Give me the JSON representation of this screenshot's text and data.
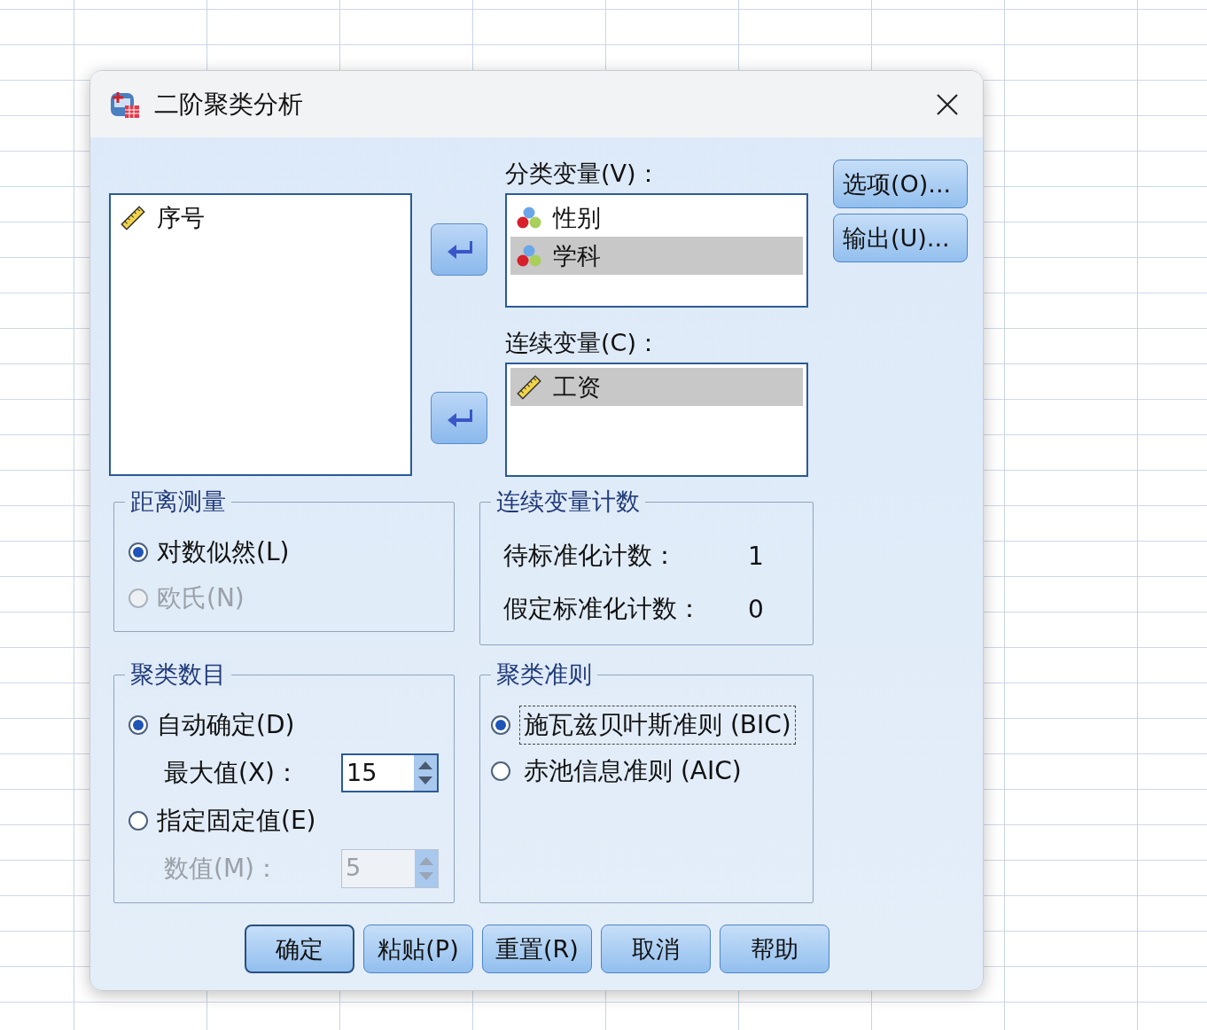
{
  "window": {
    "title": "二阶聚类分析"
  },
  "source_list": {
    "items": [
      {
        "label": "序号",
        "kind": "scale",
        "selected": false
      }
    ]
  },
  "categorical": {
    "label": "分类变量(V)：",
    "items": [
      {
        "label": "性别",
        "kind": "nominal",
        "selected": false
      },
      {
        "label": "学科",
        "kind": "nominal",
        "selected": true
      }
    ]
  },
  "continuous": {
    "label": "连续变量(C)：",
    "items": [
      {
        "label": "工资",
        "kind": "scale",
        "selected": true
      }
    ]
  },
  "side_buttons": [
    "选项(O)...",
    "输出(U)..."
  ],
  "distance": {
    "title": "距离测量",
    "options": [
      {
        "label": "对数似然(L)",
        "selected": true,
        "disabled": false
      },
      {
        "label": "欧氏(N)",
        "selected": false,
        "disabled": true
      }
    ]
  },
  "counts": {
    "title": "连续变量计数",
    "rows": [
      {
        "label": "待标准化计数：",
        "value": "1"
      },
      {
        "label": "假定标准化计数：",
        "value": "0"
      }
    ]
  },
  "cluster_number": {
    "title": "聚类数目",
    "options": [
      {
        "label": "自动确定(D)",
        "selected": true,
        "disabled": false,
        "field": {
          "label": "最大值(X)：",
          "value": "15",
          "disabled": false
        }
      },
      {
        "label": "指定固定值(E)",
        "selected": false,
        "disabled": false,
        "field": {
          "label": "数值(M)：",
          "value": "5",
          "disabled": true
        }
      }
    ]
  },
  "criterion": {
    "title": "聚类准则",
    "options": [
      {
        "label": "施瓦兹贝叶斯准则 (BIC)",
        "selected": true,
        "focused": true
      },
      {
        "label": "赤池信息准则 (AIC)",
        "selected": false,
        "focused": false
      }
    ]
  },
  "buttons": [
    {
      "label": "确定",
      "default": true
    },
    {
      "label": "粘贴(P)",
      "default": false
    },
    {
      "label": "重置(R)",
      "default": false
    },
    {
      "label": "取消",
      "default": false
    },
    {
      "label": "帮助",
      "default": false
    }
  ]
}
